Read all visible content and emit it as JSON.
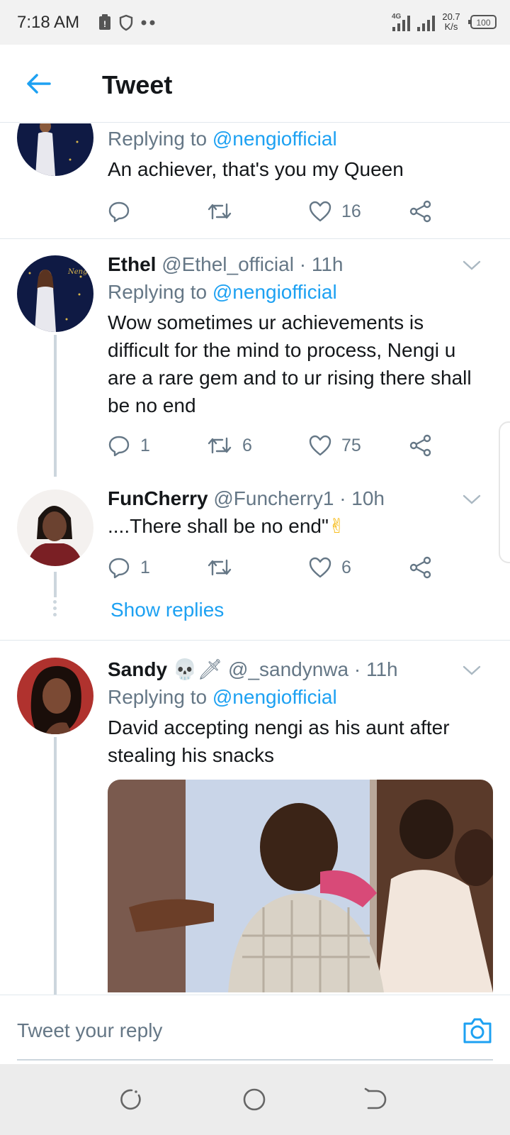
{
  "status_bar": {
    "time": "7:18 AM",
    "net_speed_value": "20.7",
    "net_speed_unit": "K/s",
    "signal_type": "4G",
    "battery": "100"
  },
  "header": {
    "title": "Tweet"
  },
  "tweets": [
    {
      "replying_label": "Replying to",
      "replying_to": "@nengiofficial",
      "text": "An achiever, that's you my Queen",
      "like_count": "16"
    },
    {
      "name": "Ethel",
      "handle": "@Ethel_official",
      "time": "· 11h",
      "replying_label": "Replying to",
      "replying_to": "@nengiofficial",
      "text": "Wow sometimes ur achievements is difficult for the mind to process, Nengi u are a rare gem and to ur rising there shall be no end",
      "reply_count": "1",
      "retweet_count": "6",
      "like_count": "75"
    },
    {
      "name": "FunCherry",
      "handle": "@Funcherry1",
      "time": "· 10h",
      "text": "....There shall be no end\"",
      "emoji": "✌",
      "reply_count": "1",
      "like_count": "6",
      "show_replies": "Show replies"
    },
    {
      "name": "Sandy",
      "name_emoji": "💀🗡",
      "handle": "@_sandynwa",
      "time": "· 11h",
      "replying_label": "Replying to",
      "replying_to": "@nengiofficial",
      "text": "David accepting nengi as his aunt after stealing his snacks"
    }
  ],
  "reply_bar": {
    "placeholder": "Tweet your reply"
  },
  "colors": {
    "accent": "#1da1f2",
    "muted": "#657786",
    "text": "#14171a",
    "divider": "#e1e8ed"
  }
}
